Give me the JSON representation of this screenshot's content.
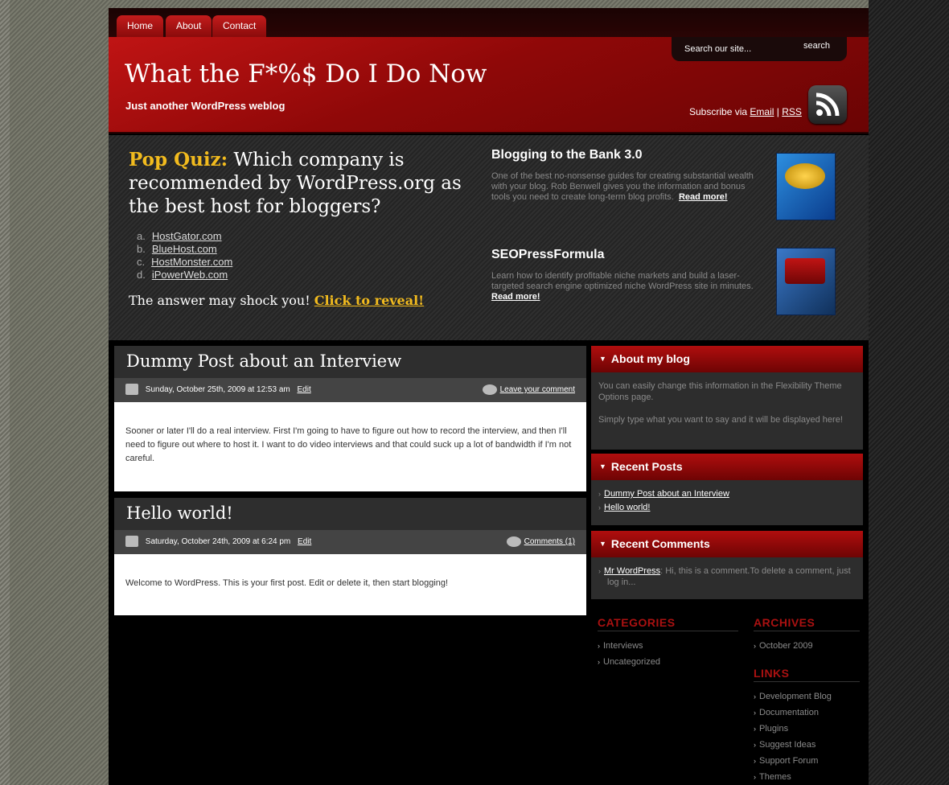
{
  "nav": {
    "tabs": [
      "Home",
      "About",
      "Contact"
    ]
  },
  "header": {
    "title": "What the F*%$ Do I Do Now",
    "tagline": "Just another WordPress weblog",
    "search_placeholder": "Search our site...",
    "search_button": "search",
    "subscribe_prefix": "Subscribe via",
    "email_link": "Email",
    "separator": "|",
    "rss_link": "RSS"
  },
  "quiz": {
    "label": "Pop Quiz:",
    "question": "Which company is recommended by WordPress.org as the best host for bloggers?",
    "options": [
      {
        "letter": "a.",
        "text": "HostGator.com"
      },
      {
        "letter": "b.",
        "text": "BlueHost.com"
      },
      {
        "letter": "c.",
        "text": "HostMonster.com"
      },
      {
        "letter": "d.",
        "text": "iPowerWeb.com"
      }
    ],
    "answer_text": "The answer may shock you!",
    "reveal_link": "Click to reveal!"
  },
  "promos": [
    {
      "title": "Blogging to the Bank 3.0",
      "text": "One of the best no-nonsense guides for creating substantial wealth with your blog. Rob Benwell gives you the information and bonus tools you need to create long-term blog profits.",
      "link": "Read more!"
    },
    {
      "title": "SEOPressFormula",
      "text": "Learn how to identify profitable niche markets and build a laser-targeted search engine optimized niche WordPress site in minutes.",
      "link": "Read more!"
    }
  ],
  "posts": [
    {
      "title": "Dummy Post about an Interview",
      "date": "Sunday, October 25th, 2009 at 12:53 am",
      "edit": "Edit",
      "comments": "Leave your comment",
      "body": "Sooner or later I'll do a real interview. First I'm going to have to figure out how to record the interview, and then I'll need to figure out where to host it. I want to do video interviews and that could suck up a lot of bandwidth if I'm not careful."
    },
    {
      "title": "Hello world!",
      "date": "Saturday, October 24th, 2009 at 6:24 pm",
      "edit": "Edit",
      "comments": "Comments (1)",
      "body": "Welcome to WordPress. This is your first post. Edit or delete it, then start blogging!"
    }
  ],
  "sidebar": {
    "about": {
      "title": "About my blog",
      "p1": "You can easily change this information in the Flexibility Theme Options page.",
      "p2": "Simply type what you want to say and it will be displayed here!"
    },
    "recent_posts": {
      "title": "Recent Posts",
      "items": [
        "Dummy Post about an Interview",
        "Hello world!"
      ]
    },
    "recent_comments": {
      "title": "Recent Comments",
      "author": "Mr WordPress",
      "excerpt": ": Hi, this is a comment.To delete a comment, just log in..."
    },
    "categories": {
      "title": "CATEGORIES",
      "items": [
        "Interviews",
        "Uncategorized"
      ]
    },
    "archives": {
      "title": "ARCHIVES",
      "items": [
        "October 2009"
      ]
    },
    "links": {
      "title": "LINKS",
      "items": [
        "Development Blog",
        "Documentation",
        "Plugins",
        "Suggest Ideas",
        "Support Forum",
        "Themes"
      ]
    }
  }
}
